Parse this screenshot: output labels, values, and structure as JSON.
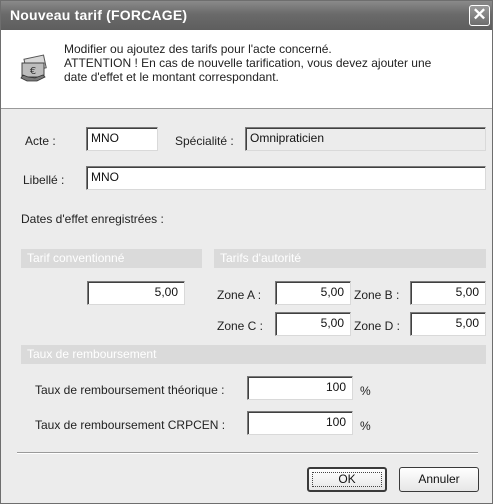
{
  "window": {
    "title": "Nouveau tarif (FORCAGE)",
    "close_glyph": "✕"
  },
  "info": {
    "icon": "money-note-icon",
    "line1": "Modifier ou ajoutez des tarifs pour l'acte concerné.",
    "line2": "ATTENTION ! En cas de nouvelle tarification, vous devez ajouter une",
    "line3": "date d'effet et le montant correspondant."
  },
  "acte": {
    "label": "Acte :",
    "value": "MNO"
  },
  "specialite": {
    "label": "Spécialité :",
    "value": "Omnipraticien"
  },
  "libelle": {
    "label": "Libellé :",
    "value": "MNO"
  },
  "dates_effet": {
    "label": "Dates d'effet enregistrées :"
  },
  "tarif_conventionne": {
    "header": "Tarif conventionné",
    "value": "5,00"
  },
  "tarifs_autorite": {
    "header": "Tarifs d'autorité",
    "zone_a": {
      "label": "Zone A :",
      "value": "5,00"
    },
    "zone_b": {
      "label": "Zone B :",
      "value": "5,00"
    },
    "zone_c": {
      "label": "Zone C :",
      "value": "5,00"
    },
    "zone_d": {
      "label": "Zone D :",
      "value": "5,00"
    }
  },
  "remboursement": {
    "header": "Taux de remboursement",
    "theorique": {
      "label": "Taux de remboursement théorique :",
      "value": "100",
      "unit": "%"
    },
    "crpcen": {
      "label": "Taux de remboursement CRPCEN :",
      "value": "100",
      "unit": "%"
    }
  },
  "buttons": {
    "ok": "OK",
    "annuler": "Annuler"
  },
  "colors": {
    "title_bar": "#6a6a6a",
    "group_header": "#dadada",
    "dialog_bg": "#ececec"
  }
}
